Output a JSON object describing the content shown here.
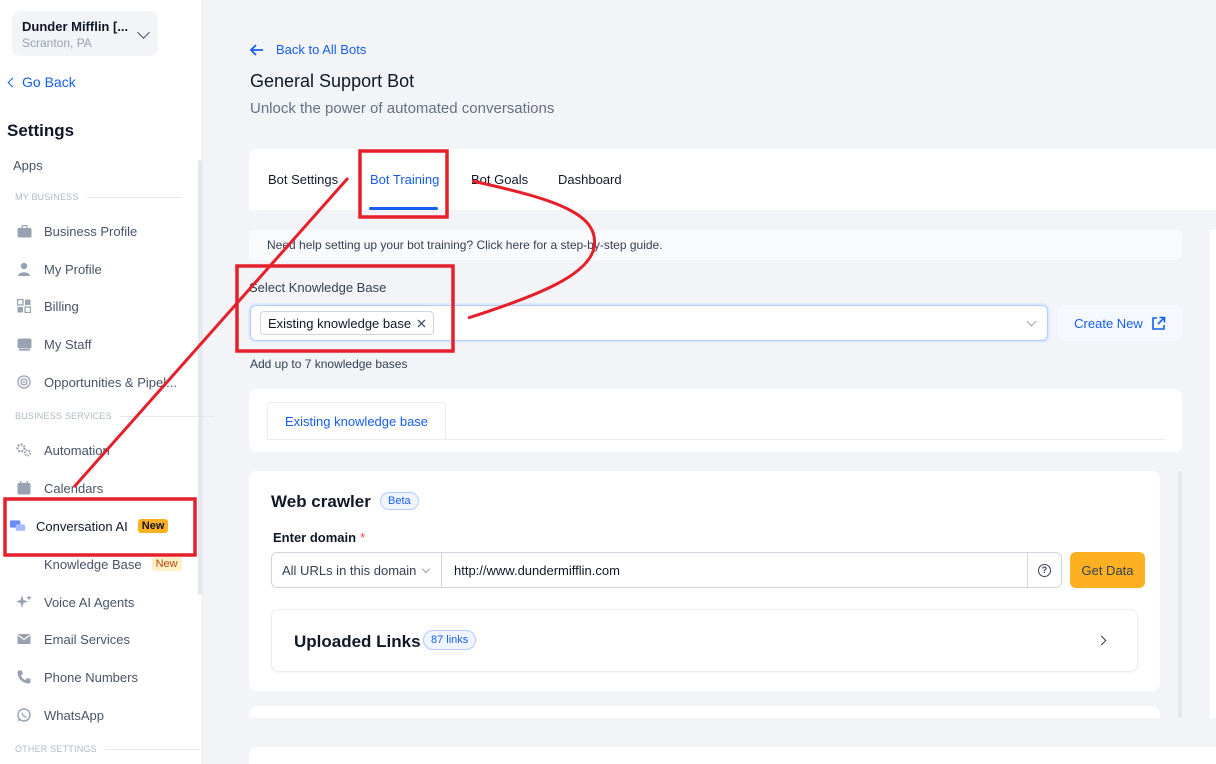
{
  "account": {
    "name": "Dunder Mifflin [...",
    "location": "Scranton, PA"
  },
  "sidebar": {
    "go_back": "Go Back",
    "title": "Settings",
    "apps": "Apps",
    "sections": {
      "my_business": "MY BUSINESS",
      "business_services": "BUSINESS SERVICES",
      "other_settings": "OTHER SETTINGS"
    },
    "items": [
      {
        "label": "Business Profile",
        "icon": "briefcase-icon"
      },
      {
        "label": "My Profile",
        "icon": "person-icon"
      },
      {
        "label": "Billing",
        "icon": "billing-icon"
      },
      {
        "label": "My Staff",
        "icon": "staff-icon"
      },
      {
        "label": "Opportunities & Pipel...",
        "icon": "target-icon"
      },
      {
        "label": "Automation",
        "icon": "gears-icon"
      },
      {
        "label": "Calendars",
        "icon": "calendar-icon"
      },
      {
        "label": "Conversation AI",
        "icon": "chat-icon",
        "badge": "New"
      },
      {
        "label": "Knowledge Base",
        "badge": "New"
      },
      {
        "label": "Voice AI Agents",
        "icon": "sparkle-icon"
      },
      {
        "label": "Email Services",
        "icon": "email-icon"
      },
      {
        "label": "Phone Numbers",
        "icon": "phone-icon"
      },
      {
        "label": "WhatsApp",
        "icon": "whatsapp-icon"
      }
    ]
  },
  "header": {
    "back_link": "Back to All Bots",
    "title": "General Support Bot",
    "subtitle": "Unlock the power of automated conversations"
  },
  "tabs": [
    "Bot Settings",
    "Bot Training",
    "Bot Goals",
    "Dashboard"
  ],
  "training": {
    "help_text": "Need help setting up your bot training? Click here for a step-by-step guide.",
    "kb_label": "Select Knowledge Base",
    "kb_selected": "Existing knowledge base",
    "create_new": "Create New",
    "kb_hint": "Add up to 7 knowledge bases",
    "kb_tab": "Existing knowledge base"
  },
  "crawler": {
    "title": "Web crawler",
    "beta": "Beta",
    "domain_label": "Enter domain",
    "required_mark": "*",
    "scope": "All URLs in this domain",
    "url": "http://www.dundermifflin.com",
    "help": "?",
    "get_data": "Get Data",
    "uploaded_links": "Uploaded Links",
    "links_count": "87 links"
  },
  "colors": {
    "accent": "#155eef",
    "annotation": "#e5202a",
    "get_data": "#fdb022"
  }
}
